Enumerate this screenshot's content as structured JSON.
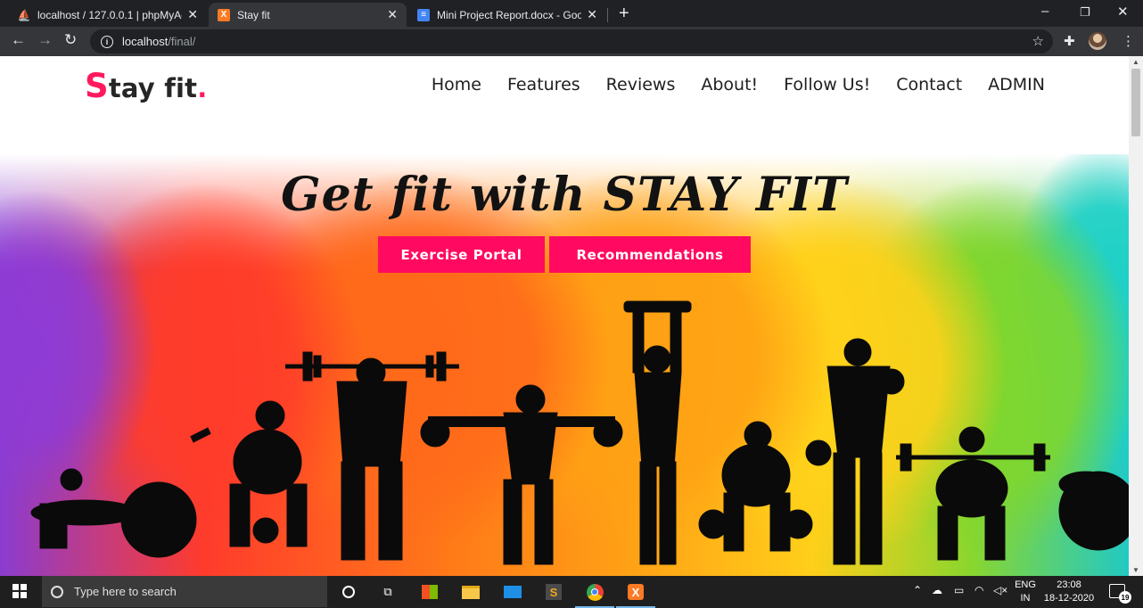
{
  "browser": {
    "tabs": [
      {
        "title": "localhost / 127.0.0.1 | phpMyAdm",
        "icon": "phpmyadmin-icon",
        "active": false
      },
      {
        "title": "Stay fit",
        "icon": "xampp-icon",
        "active": true
      },
      {
        "title": "Mini Project Report.docx - Googl",
        "icon": "google-docs-icon",
        "active": false
      }
    ],
    "new_tab_label": "+",
    "address": {
      "host": "localhost",
      "path": "/final/"
    },
    "window_controls": {
      "minimize": "–",
      "maximize": "❐",
      "close": "✕"
    }
  },
  "site": {
    "brand": {
      "first": "S",
      "rest": "tay fit",
      "dot": "."
    },
    "nav": [
      "Home",
      "Features",
      "Reviews",
      "About!",
      "Follow Us!",
      "Contact",
      "ADMIN"
    ],
    "hero_title": "Get fit with STAY FIT",
    "buttons": {
      "exercise": "Exercise Portal",
      "recommend": "Recommendations"
    },
    "accent_color": "#ff0a60"
  },
  "taskbar": {
    "search_placeholder": "Type here to search",
    "lang_line1": "ENG",
    "lang_line2": "IN",
    "time": "23:08",
    "date": "18-12-2020",
    "notifications": "19"
  }
}
